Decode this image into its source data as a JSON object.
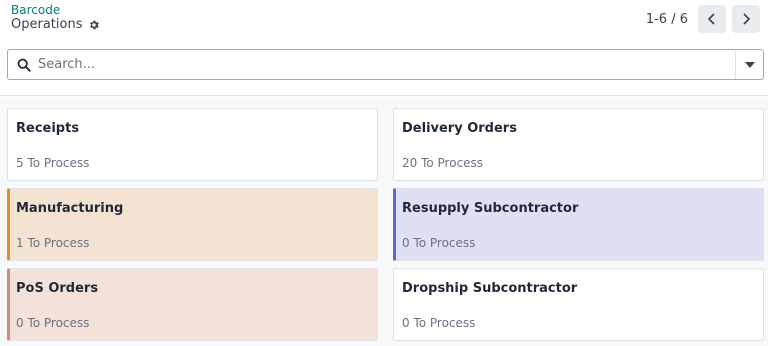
{
  "breadcrumb": {
    "parent": "Barcode",
    "current": "Operations"
  },
  "pager": {
    "value": "1-6 / 6"
  },
  "search": {
    "placeholder": "Search..."
  },
  "cards": [
    {
      "title": "Receipts",
      "count": "5 To Process",
      "color": "#ffffff",
      "accent": null
    },
    {
      "title": "Delivery Orders",
      "count": "20 To Process",
      "color": "#ffffff",
      "accent": null
    },
    {
      "title": "Manufacturing",
      "count": "1 To Process",
      "color": "#f4e2d2",
      "accent": "#e18e2c"
    },
    {
      "title": "Resupply Subcontractor",
      "count": "0 To Process",
      "color": "#dde1f3",
      "accent": "#5a6acf"
    },
    {
      "title": "PoS Orders",
      "count": "0 To Process",
      "color": "#f3e1da",
      "accent": "#d98a6a"
    },
    {
      "title": "Dropship Subcontractor",
      "count": "0 To Process",
      "color": "#ffffff",
      "accent": null
    }
  ],
  "colors": {
    "link": "#017e84",
    "search_border": "#6cc1bf"
  }
}
